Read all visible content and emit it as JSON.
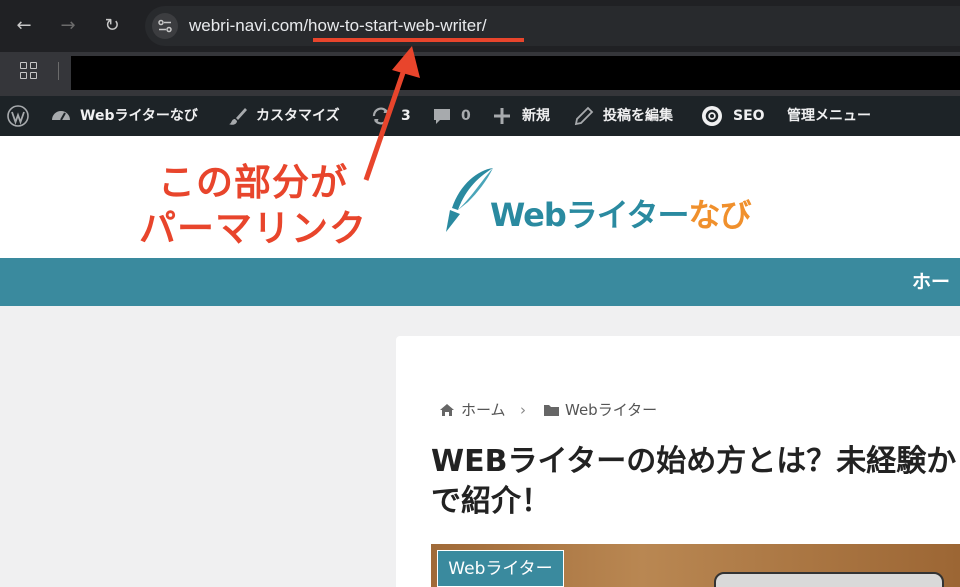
{
  "browser": {
    "url_host": "webri-navi.com",
    "url_path": "/how-to-start-web-writer/"
  },
  "annotation": {
    "line1": "この部分が",
    "line2": "パーマリンク",
    "color": "#e8452c"
  },
  "admin_bar": {
    "site_name": "Webライターなび",
    "customize": "カスタマイズ",
    "updates_count": "3",
    "comments_count": "0",
    "new_label": "新規",
    "edit_post": "投稿を編集",
    "seo": "SEO",
    "admin_menu": "管理メニュー"
  },
  "site": {
    "logo_part1": "Web",
    "logo_part2": "ライター",
    "logo_part3": "なび",
    "nav_home": "ホー",
    "brand_color": "#3a8a9e",
    "accent_color": "#f0902c"
  },
  "breadcrumb": {
    "home": "ホーム",
    "category": "Webライター"
  },
  "post": {
    "title_line1": "WEBライターの始め方とは？未経験か",
    "title_line2": "で紹介！",
    "category_tag": "Webライター"
  }
}
